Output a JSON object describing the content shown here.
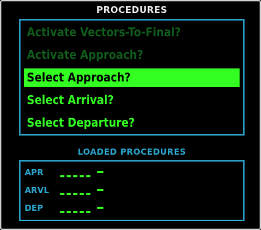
{
  "title": "PROCEDURES",
  "menu": {
    "items": [
      {
        "label": "Activate Vectors-To-Final?",
        "state": "disabled"
      },
      {
        "label": "Activate Approach?",
        "state": "disabled"
      },
      {
        "label": "Select Approach?",
        "state": "selected"
      },
      {
        "label": "Select Arrival?",
        "state": "enabled"
      },
      {
        "label": "Select Departure?",
        "state": "enabled"
      }
    ]
  },
  "loaded": {
    "title": "LOADED PROCEDURES",
    "rows": [
      {
        "label": "APR",
        "value": "____ -"
      },
      {
        "label": "ARVL",
        "value": "____ -"
      },
      {
        "label": "DEP",
        "value": "____ -"
      }
    ]
  },
  "colors": {
    "enabled": "#33ff22",
    "disabled": "#0f5a1a",
    "accent": "#2aa2c9",
    "title": "#e8e8e8"
  }
}
